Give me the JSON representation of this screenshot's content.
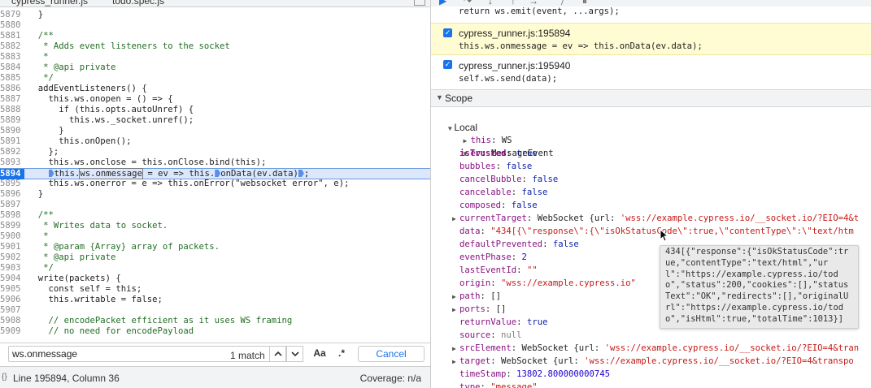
{
  "editor": {
    "tabs": [
      {
        "label": "cypress_runner.js",
        "close": "×"
      },
      {
        "label": "todo.spec.js"
      }
    ],
    "lines": [
      {
        "n": "5879",
        "t": "  }"
      },
      {
        "n": "5880",
        "t": ""
      },
      {
        "n": "5881",
        "t": "  /**",
        "c": true
      },
      {
        "n": "5882",
        "t": "   * Adds event listeners to the socket",
        "c": true
      },
      {
        "n": "5883",
        "t": "   *",
        "c": true
      },
      {
        "n": "5884",
        "t": "   * @api private",
        "c": true
      },
      {
        "n": "5885",
        "t": "   */",
        "c": true
      },
      {
        "n": "5886",
        "t": "  addEventListeners() {"
      },
      {
        "n": "5887",
        "t": "    this.ws.onopen = () => {"
      },
      {
        "n": "5888",
        "t": "      if (this.opts.autoUnref) {"
      },
      {
        "n": "5889",
        "t": "        this.ws._socket.unref();"
      },
      {
        "n": "5890",
        "t": "      }"
      },
      {
        "n": "5891",
        "t": "      this.onOpen();"
      },
      {
        "n": "5892",
        "t": "    };"
      },
      {
        "n": "5893",
        "t": "    this.ws.onclose = this.onClose.bind(this);"
      },
      {
        "n": "5894",
        "t": "",
        "current": true
      },
      {
        "n": "5895",
        "t": "    this.ws.onerror = e => this.onError(\"websocket error\", e);"
      },
      {
        "n": "5896",
        "t": "  }"
      },
      {
        "n": "5897",
        "t": ""
      },
      {
        "n": "5898",
        "t": "  /**",
        "c": true
      },
      {
        "n": "5899",
        "t": "   * Writes data to socket.",
        "c": true
      },
      {
        "n": "5900",
        "t": "   *",
        "c": true
      },
      {
        "n": "5901",
        "t": "   * @param {Array} array of packets.",
        "c": true
      },
      {
        "n": "5902",
        "t": "   * @api private",
        "c": true
      },
      {
        "n": "5903",
        "t": "   */",
        "c": true
      },
      {
        "n": "5904",
        "t": "  write(packets) {"
      },
      {
        "n": "5905",
        "t": "    const self = this;"
      },
      {
        "n": "5906",
        "t": "    this.writable = false;"
      },
      {
        "n": "5907",
        "t": ""
      },
      {
        "n": "5908",
        "t": "    // encodePacket efficient as it uses WS framing",
        "c": true
      },
      {
        "n": "5909",
        "t": "    // no need for encodePayload",
        "c": true
      }
    ],
    "current_line": {
      "part1": "this.",
      "part2": "ws.onmessage",
      "part3": " = ev => this.",
      "part4": "onData(ev.data)",
      "part5": ";"
    },
    "search": {
      "value": "ws.onmessage",
      "match_count": "1 match",
      "prev": "⌃",
      "next": "⌄",
      "match_case": "Aa",
      "regex": ".*",
      "cancel": "Cancel"
    },
    "status": {
      "position": "Line 195894, Column 36",
      "coverage": "Coverage: n/a",
      "icon": "{}"
    }
  },
  "debugger": {
    "prev_code": "return ws.emit(event, ...args);",
    "breakpoints": [
      {
        "location": "cypress_runner.js:195894",
        "code": "this.ws.onmessage = ev => this.onData(ev.data);",
        "hit": true
      },
      {
        "location": "cypress_runner.js:195940",
        "code": "self.ws.send(data);",
        "hit": false
      }
    ],
    "scope": {
      "title": "Scope",
      "local": "Local",
      "this_key": "this",
      "this_val": "WS",
      "ev_key": "ev",
      "ev_val": "MessageEvent",
      "rows": [
        {
          "k": "isTrusted",
          "v": "true",
          "vt": "kw",
          "own": true
        },
        {
          "k": "bubbles",
          "v": "false",
          "vt": "kw"
        },
        {
          "k": "cancelBubble",
          "v": "false",
          "vt": "kw"
        },
        {
          "k": "cancelable",
          "v": "false",
          "vt": "kw"
        },
        {
          "k": "composed",
          "v": "false",
          "vt": "kw"
        },
        {
          "k": "currentTarget",
          "v": "WebSocket {url: ",
          "v2": "'wss://example.cypress.io/__socket.io/?EIO=4&t",
          "vt": "obj",
          "tri": true
        },
        {
          "k": "data",
          "v": "\"434[{\\\"response\\\":{\\\"isOkStatusCode\\\":true,\\\"contentType\\\":\\\"text/htm",
          "vt": "str"
        },
        {
          "k": "defaultPrevented",
          "v": "false",
          "vt": "kw"
        },
        {
          "k": "eventPhase",
          "v": "2",
          "vt": "num"
        },
        {
          "k": "lastEventId",
          "v": "\"\"",
          "vt": "str"
        },
        {
          "k": "origin",
          "v": "\"wss://example.cypress.io\"",
          "vt": "str"
        },
        {
          "k": "path",
          "v": "[]",
          "vt": "obj",
          "tri": true
        },
        {
          "k": "ports",
          "v": "[]",
          "vt": "obj",
          "tri": true
        },
        {
          "k": "returnValue",
          "v": "true",
          "vt": "kw"
        },
        {
          "k": "source",
          "v": "null",
          "vt": "nul"
        },
        {
          "k": "srcElement",
          "v": "WebSocket {url: ",
          "v2": "'wss://example.cypress.io/__socket.io/?EIO=4&tran",
          "vt": "obj",
          "tri": true
        },
        {
          "k": "target",
          "v": "WebSocket {url: ",
          "v2": "'wss://example.cypress.io/__socket.io/?EIO=4&transpo",
          "vt": "obj",
          "tri": true
        },
        {
          "k": "timeStamp",
          "v": "13802.800000000745",
          "vt": "num"
        },
        {
          "k": "type",
          "v": "\"message\"",
          "vt": "str"
        }
      ]
    }
  },
  "tooltip": {
    "text": "434[{\"response\":{\"isOkStatusCode\":true,\"contentType\":\"text/html\",\"url\":\"https://example.cypress.io/todo\",\"status\":200,\"cookies\":[],\"statusText\":\"OK\",\"redirects\":[],\"originalUrl\":\"https://example.cypress.io/todo\",\"isHtml\":true,\"totalTime\":1013}]"
  },
  "colors": {
    "accent": "#1a73e8",
    "breakpoint_hit": "#fffbd2",
    "current_line": "#dce7fb"
  }
}
